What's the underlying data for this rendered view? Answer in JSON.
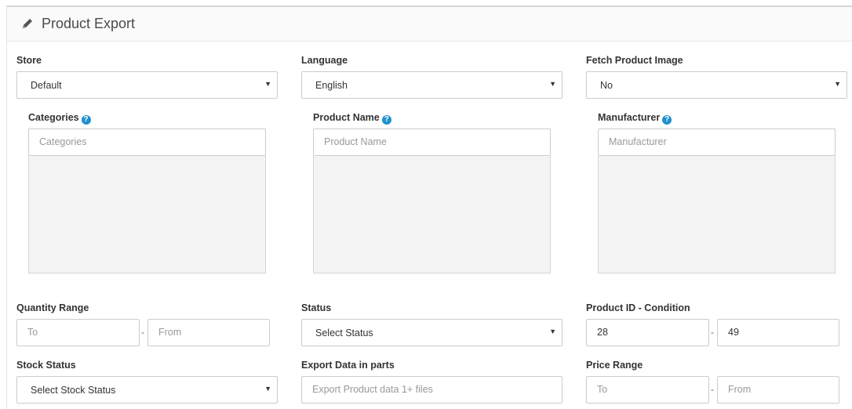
{
  "panel": {
    "title": "Product Export",
    "icon": "pencil-icon"
  },
  "store": {
    "label": "Store",
    "value": "Default"
  },
  "language": {
    "label": "Language",
    "value": "English"
  },
  "fetch_image": {
    "label": "Fetch Product Image",
    "value": "No"
  },
  "categories": {
    "label": "Categories",
    "placeholder": "Categories"
  },
  "product_name": {
    "label": "Product Name",
    "placeholder": "Product Name"
  },
  "manufacturer": {
    "label": "Manufacturer",
    "placeholder": "Manufacturer"
  },
  "quantity_range": {
    "label": "Quantity Range",
    "to_placeholder": "To",
    "from_placeholder": "From",
    "separator": "-"
  },
  "status": {
    "label": "Status",
    "value": "Select Status"
  },
  "product_id": {
    "label": "Product ID - Condition",
    "from_value": "28",
    "to_value": "49",
    "separator": "-"
  },
  "stock_status": {
    "label": "Stock Status",
    "value": "Select Stock Status"
  },
  "export_parts": {
    "label": "Export Data in parts",
    "placeholder": "Export Product data 1+ files"
  },
  "price_range": {
    "label": "Price Range",
    "to_placeholder": "To",
    "from_placeholder": "From",
    "separator": "-"
  },
  "help_glyph": "?",
  "caret_glyph": "▼",
  "colors": {
    "accent": "#1e91cf",
    "border": "#cccccc",
    "well": "#f4f4f4"
  }
}
